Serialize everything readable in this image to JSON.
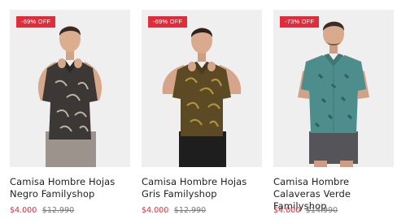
{
  "products": [
    {
      "badge": "-69% OFF",
      "title": "Camisa Hombre Hojas Negro Familyshop",
      "price": "$4.000",
      "old_price": "$12.990",
      "shirt_color": "#3b3835",
      "pattern_color": "#bdb3a6",
      "pants_color": "#9c948c"
    },
    {
      "badge": "-69% OFF",
      "title": "Camisa Hombre Hojas Gris Familyshop",
      "price": "$4.000",
      "old_price": "$12.990",
      "shirt_color": "#5b4a23",
      "pattern_color": "#b09440",
      "pants_color": "#1e1e1e"
    },
    {
      "badge": "-73% OFF",
      "title": "Camisa Hombre Calaveras Verde Familyshop",
      "price": "$4.000",
      "old_price": "$14.990",
      "shirt_color": "#4d8e8c",
      "pattern_color": "#2e5e5c",
      "pants_color": "#555559"
    }
  ],
  "colors": {
    "accent": "#e32c3a",
    "image_bg": "#efefef"
  }
}
